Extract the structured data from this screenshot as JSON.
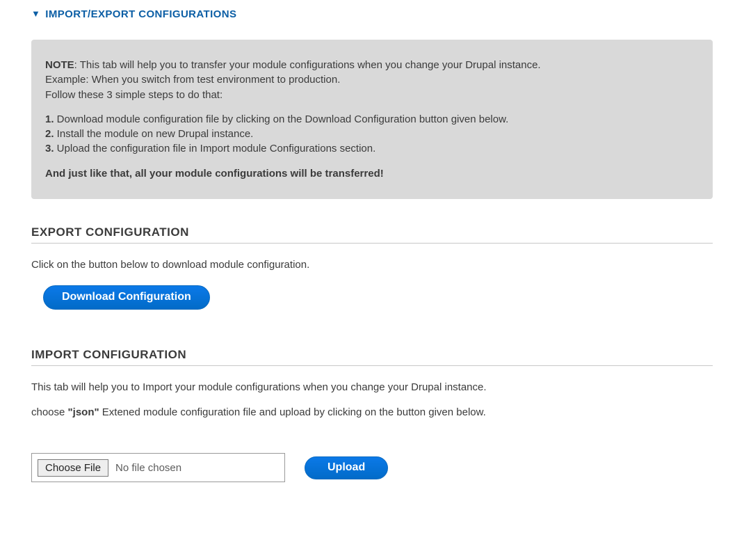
{
  "header": {
    "title": "IMPORT/EXPORT CONFIGURATIONS"
  },
  "note": {
    "label": "NOTE",
    "line1": ": This tab will help you to transfer your module configurations when you change your Drupal instance.",
    "line2": "Example: When you switch from test environment to production.",
    "line3": "Follow these 3 simple steps to do that:",
    "s1_num": "1.",
    "s1_text": " Download module configuration file by clicking on the Download Configuration button given below.",
    "s2_num": "2.",
    "s2_text": " Install the module on new Drupal instance.",
    "s3_num": "3.",
    "s3_text": " Upload the configuration file in Import module Configurations section.",
    "conclusion": "And just like that, all your module configurations will be transferred!"
  },
  "export": {
    "heading": "EXPORT CONFIGURATION",
    "desc": "Click on the button below to download module configuration.",
    "button": "Download Configuration"
  },
  "import": {
    "heading": "IMPORT CONFIGURATION",
    "desc1": "This tab will help you to Import your module configurations when you change your Drupal instance.",
    "desc2_pre": "choose ",
    "desc2_bold": "\"json\"",
    "desc2_post": " Extened module configuration file and upload by clicking on the button given below.",
    "choose_file": "Choose File",
    "file_status": "No file chosen",
    "upload_button": "Upload"
  }
}
